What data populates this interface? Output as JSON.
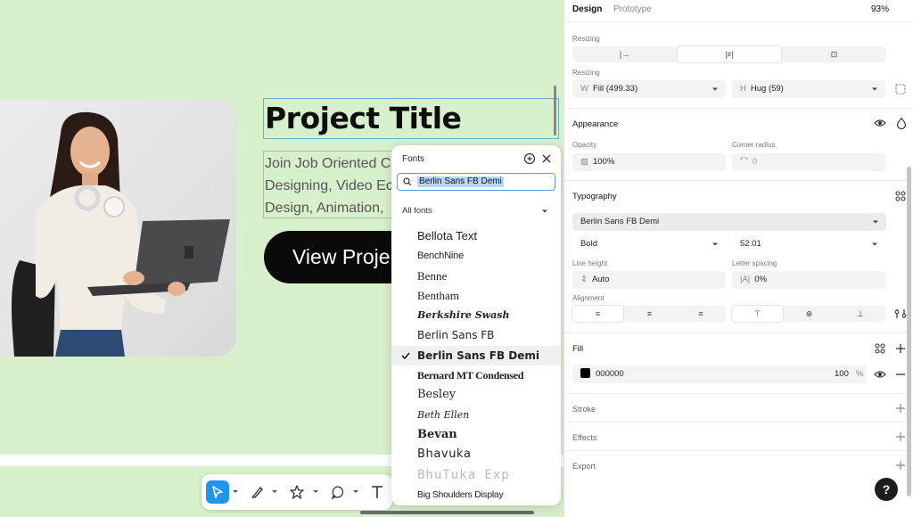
{
  "canvas": {
    "project_title": "Project Title",
    "description_lines": [
      "Join Job Oriented C",
      "Designing, Video Ec",
      "Design, Animation,"
    ],
    "view_button_label": "View Proje"
  },
  "toolbar": {
    "tools": [
      "move-tool",
      "pen-tool",
      "shape-tool",
      "comment-tool",
      "text-tool"
    ]
  },
  "font_panel": {
    "title": "Fonts",
    "search_value": "Berlin Sans FB Demi",
    "filter_label": "All fonts",
    "selected_font": "Berlin Sans FB Demi",
    "fonts": [
      "Bellota Text",
      "BenchNine",
      "Benne",
      "Bentham",
      "Berkshire Swash",
      "Berlin Sans FB",
      "Berlin Sans FB Demi",
      "Bernard MT Condensed",
      "Besley",
      "Beth Ellen",
      "Bevan",
      "Bhavuka",
      "BhuTuka Exp",
      "Big Shoulders Display"
    ]
  },
  "props": {
    "tabs": {
      "design": "Design",
      "prototype": "Prototype"
    },
    "zoom": "93%",
    "resizing_label": "Resizing",
    "resizing_label_2": "Resizing",
    "width_prefix": "W",
    "width_value": "Fill (499.33)",
    "height_prefix": "H",
    "height_value": "Hug (59)",
    "appearance": {
      "title": "Appearance",
      "opacity_label": "Opacity",
      "opacity_value": "100%",
      "radius_label": "Corner radius",
      "radius_value": "0"
    },
    "typography": {
      "title": "Typography",
      "font_family": "Berlin Sans FB Demi",
      "weight": "Bold",
      "size": "52.01",
      "line_height_label": "Line height",
      "line_height_value": "Auto",
      "letter_spacing_label": "Letter spacing",
      "letter_spacing_value": "0%",
      "alignment_label": "Alignment"
    },
    "fill": {
      "title": "Fill",
      "hex": "000000",
      "opacity": "100",
      "unit": "%",
      "swatch_color": "#000000"
    },
    "stroke_title": "Stroke",
    "effects_title": "Effects",
    "export_title": "Export",
    "help": "?"
  },
  "colors": {
    "canvas_bg": "#d9f0cc",
    "accent_blue": "#1e96f0",
    "selection_blue": "#5aa0e0"
  }
}
